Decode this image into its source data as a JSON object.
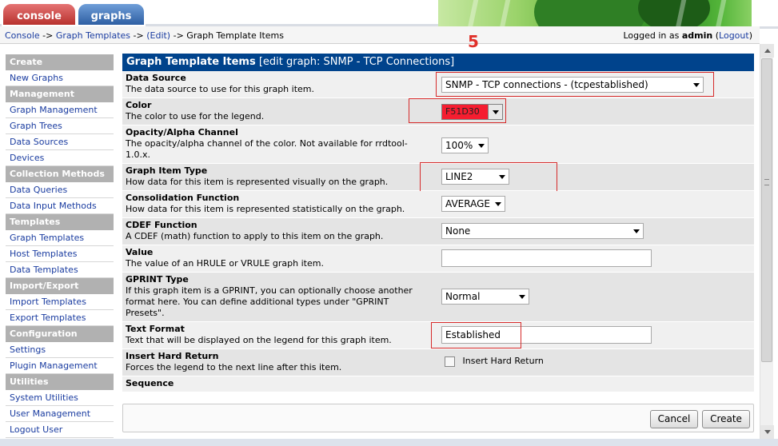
{
  "tabs": [
    {
      "label": "console"
    },
    {
      "label": "graphs"
    }
  ],
  "breadcrumb": {
    "console": "Console",
    "sep1": " -> ",
    "graph_templates": "Graph Templates",
    "sep2": " -> ",
    "edit": "(Edit)",
    "sep3": " -> ",
    "current": "Graph Template Items"
  },
  "login": {
    "prefix": "Logged in as ",
    "user": "admin",
    "logout_open": " (",
    "logout": "Logout",
    "logout_close": ")"
  },
  "annotation": "5",
  "sidebar": [
    {
      "type": "head",
      "label": "Create"
    },
    {
      "type": "item",
      "label": "New Graphs"
    },
    {
      "type": "head",
      "label": "Management"
    },
    {
      "type": "item",
      "label": "Graph Management"
    },
    {
      "type": "item",
      "label": "Graph Trees"
    },
    {
      "type": "item",
      "label": "Data Sources"
    },
    {
      "type": "item",
      "label": "Devices"
    },
    {
      "type": "head",
      "label": "Collection Methods"
    },
    {
      "type": "item",
      "label": "Data Queries"
    },
    {
      "type": "item",
      "label": "Data Input Methods"
    },
    {
      "type": "head",
      "label": "Templates"
    },
    {
      "type": "item",
      "label": "Graph Templates"
    },
    {
      "type": "item",
      "label": "Host Templates"
    },
    {
      "type": "item",
      "label": "Data Templates"
    },
    {
      "type": "head",
      "label": "Import/Export"
    },
    {
      "type": "item",
      "label": "Import Templates"
    },
    {
      "type": "item",
      "label": "Export Templates"
    },
    {
      "type": "head",
      "label": "Configuration"
    },
    {
      "type": "item",
      "label": "Settings"
    },
    {
      "type": "item",
      "label": "Plugin Management"
    },
    {
      "type": "head",
      "label": "Utilities"
    },
    {
      "type": "item",
      "label": "System Utilities"
    },
    {
      "type": "item",
      "label": "User Management"
    },
    {
      "type": "item",
      "label": "Logout User"
    }
  ],
  "panel": {
    "title": "Graph Template Items",
    "subtitle": "[edit graph: SNMP - TCP Connections]"
  },
  "fields": {
    "data_source": {
      "label": "Data Source",
      "desc": "The data source to use for this graph item.",
      "value": "SNMP - TCP connections - (tcpestablished)"
    },
    "color": {
      "label": "Color",
      "desc": "The color to use for the legend.",
      "value": "F51D30",
      "swatch": "#f51d30"
    },
    "opacity": {
      "label": "Opacity/Alpha Channel",
      "desc": "The opacity/alpha channel of the color. Not available for rrdtool-1.0.x.",
      "value": "100%"
    },
    "item_type": {
      "label": "Graph Item Type",
      "desc": "How data for this item is represented visually on the graph.",
      "value": "LINE2"
    },
    "consolidation": {
      "label": "Consolidation Function",
      "desc": "How data for this item is represented statistically on the graph.",
      "value": "AVERAGE"
    },
    "cdef": {
      "label": "CDEF Function",
      "desc": "A CDEF (math) function to apply to this item on the graph.",
      "value": "None"
    },
    "value": {
      "label": "Value",
      "desc": "The value of an HRULE or VRULE graph item.",
      "value": ""
    },
    "gprint": {
      "label": "GPRINT Type",
      "desc": "If this graph item is a GPRINT, you can optionally choose another format here. You can define additional types under \"GPRINT Presets\".",
      "value": "Normal"
    },
    "text_format": {
      "label": "Text Format",
      "desc": "Text that will be displayed on the legend for this graph item.",
      "value": "Established"
    },
    "hard_return": {
      "label": "Insert Hard Return",
      "desc": "Forces the legend to the next line after this item.",
      "checkbox_label": "Insert Hard Return",
      "checked": false
    },
    "sequence": {
      "label": "Sequence"
    }
  },
  "buttons": {
    "cancel": "Cancel",
    "create": "Create"
  },
  "colors": {
    "header_bg": "#00438c",
    "highlight_box": "#d62a2a",
    "link": "#1a3ca0"
  }
}
